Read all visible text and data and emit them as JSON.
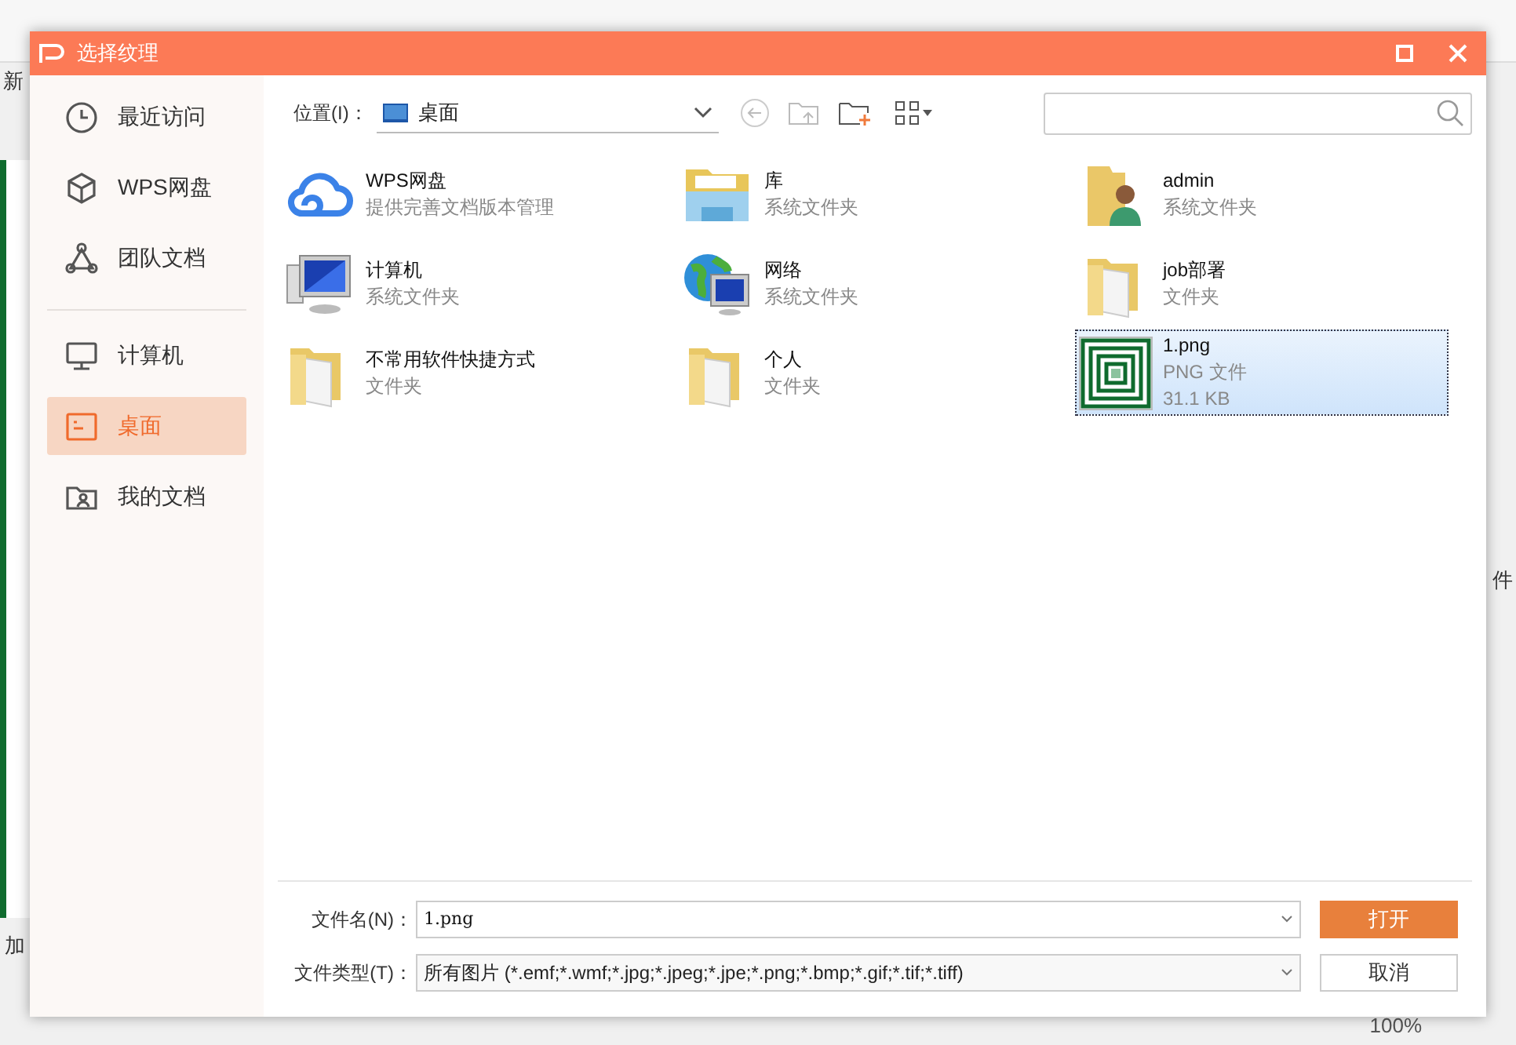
{
  "background_app": {
    "top_left_label": "新",
    "bottom_left_label": "加",
    "right_label": "件",
    "zoom": "100%"
  },
  "dialog": {
    "title": "选择纹理"
  },
  "sidebar": {
    "groups": [
      [
        {
          "label": "最近访问",
          "selected": false
        },
        {
          "label": "WPS网盘",
          "selected": false
        },
        {
          "label": "团队文档",
          "selected": false
        }
      ],
      [
        {
          "label": "计算机",
          "selected": false
        },
        {
          "label": "桌面",
          "selected": true
        },
        {
          "label": "我的文档",
          "selected": false
        }
      ]
    ]
  },
  "location": {
    "label": "位置(I)：",
    "value": "桌面"
  },
  "files": [
    {
      "name": "WPS网盘",
      "details": [
        "提供完善文档版本管理"
      ],
      "selected": false
    },
    {
      "name": "库",
      "details": [
        "系统文件夹"
      ],
      "selected": false
    },
    {
      "name": "admin",
      "details": [
        "系统文件夹"
      ],
      "selected": false
    },
    {
      "name": "计算机",
      "details": [
        "系统文件夹"
      ],
      "selected": false
    },
    {
      "name": "网络",
      "details": [
        "系统文件夹"
      ],
      "selected": false
    },
    {
      "name": "job部署",
      "details": [
        "文件夹"
      ],
      "selected": false
    },
    {
      "name": "不常用软件快捷方式",
      "details": [
        "文件夹"
      ],
      "selected": false
    },
    {
      "name": "个人",
      "details": [
        "文件夹"
      ],
      "selected": false
    },
    {
      "name": "1.png",
      "details": [
        "PNG 文件",
        "31.1 KB"
      ],
      "selected": true
    }
  ],
  "file_name": {
    "label": "文件名(N)：",
    "value": "1.png"
  },
  "file_type": {
    "label": "文件类型(T)：",
    "value": "所有图片 (*.emf;*.wmf;*.jpg;*.jpeg;*.jpe;*.png;*.bmp;*.gif;*.tif;*.tiff)"
  },
  "buttons": [
    {
      "label": "打开",
      "kind": "primary"
    },
    {
      "label": "取消",
      "kind": "secondary"
    }
  ]
}
